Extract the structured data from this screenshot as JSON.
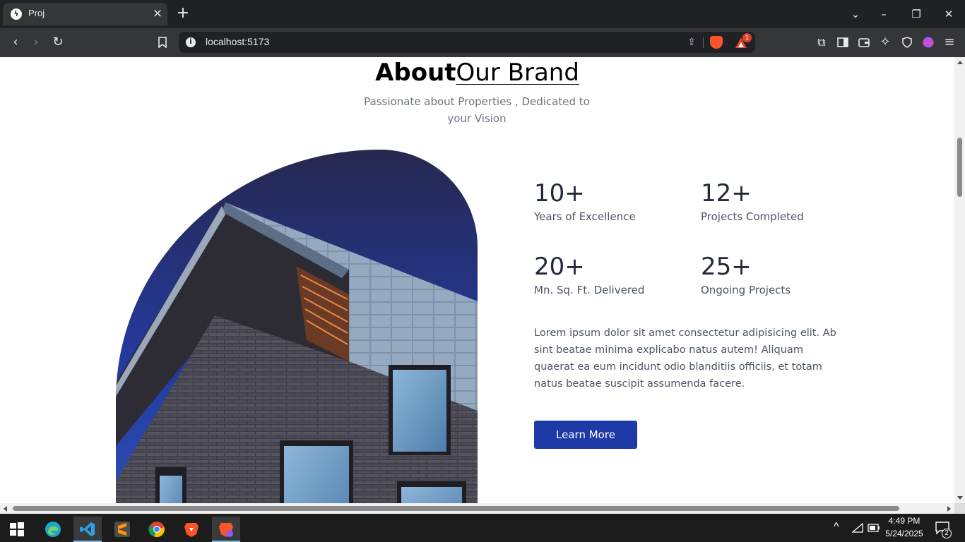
{
  "browser": {
    "tab_title": "Proj",
    "url": "localhost:5173",
    "rewards_badge": "1"
  },
  "page": {
    "heading_bold": "About",
    "heading_rest": "Our Brand",
    "subtitle": "Passionate about Properties , Dedicated to your Vision",
    "stats": [
      {
        "value": "10+",
        "label": "Years of Excellence"
      },
      {
        "value": "12+",
        "label": "Projects Completed"
      },
      {
        "value": "20+",
        "label": "Mn. Sq. Ft. Delivered"
      },
      {
        "value": "25+",
        "label": "Ongoing Projects"
      }
    ],
    "paragraph": "Lorem ipsum dolor sit amet consectetur adipisicing elit. Ab sint beatae minima explicabo natus autem! Aliquam quaerat ea eum incidunt odio blanditiis officiis, et totam natus beatae suscipit assumenda facere.",
    "button_label": "Learn More"
  },
  "taskbar": {
    "time": "4:49 PM",
    "date": "5/24/2025",
    "notification_count": "2",
    "apps": [
      "start-icon",
      "edge-icon",
      "vscode-icon",
      "sublime-icon",
      "chrome-icon",
      "brave-icon",
      "brave-nightly-icon"
    ]
  },
  "colors": {
    "accent": "#1e3aa6",
    "heading": "#000000",
    "stat_value": "#1f2937",
    "body_text": "#4b5563"
  }
}
